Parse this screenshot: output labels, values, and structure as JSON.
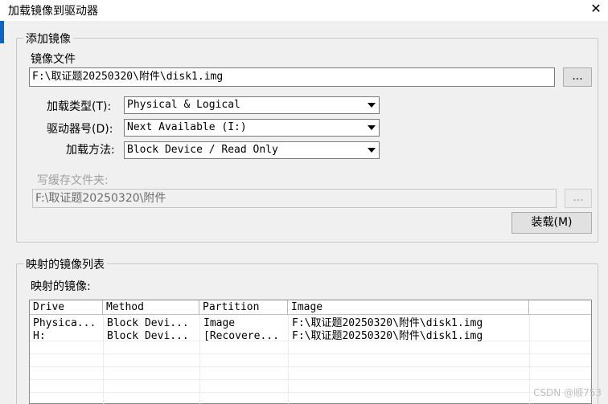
{
  "window": {
    "title": "加载镜像到驱动器",
    "close_glyph": "✕"
  },
  "add_image": {
    "group_label": "添加镜像",
    "image_file_label": "镜像文件",
    "image_file_value": "F:\\取证题20250320\\附件\\disk1.img",
    "browse_label": "...",
    "mount_type_label": "加载类型(T):",
    "mount_type_value": "Physical & Logical",
    "drive_letter_label": "驱动器号(D):",
    "drive_letter_value": "Next Available (I:)",
    "mount_method_label": "加载方法:",
    "mount_method_value": "Block Device / Read Only",
    "write_cache_label": "写缓存文件夹:",
    "write_cache_value": "F:\\取证题20250320\\附件",
    "write_cache_browse_label": "...",
    "mount_button_label": "装载(M)"
  },
  "mapped": {
    "group_label": "映射的镜像列表",
    "list_label": "映射的镜像:",
    "columns": [
      "Drive",
      "Method",
      "Partition",
      "Image"
    ],
    "rows": [
      [
        "Physica...",
        "Block Devi...",
        "Image",
        "F:\\取证题20250320\\附件\\disk1.img"
      ],
      [
        "H:",
        "Block Devi...",
        "[Recovere...",
        "F:\\取证题20250320\\附件\\disk1.img"
      ]
    ]
  },
  "watermark": "CSDN @顺753",
  "colors": {
    "accent": "#0a64c8",
    "background": "#f0f0f0"
  }
}
